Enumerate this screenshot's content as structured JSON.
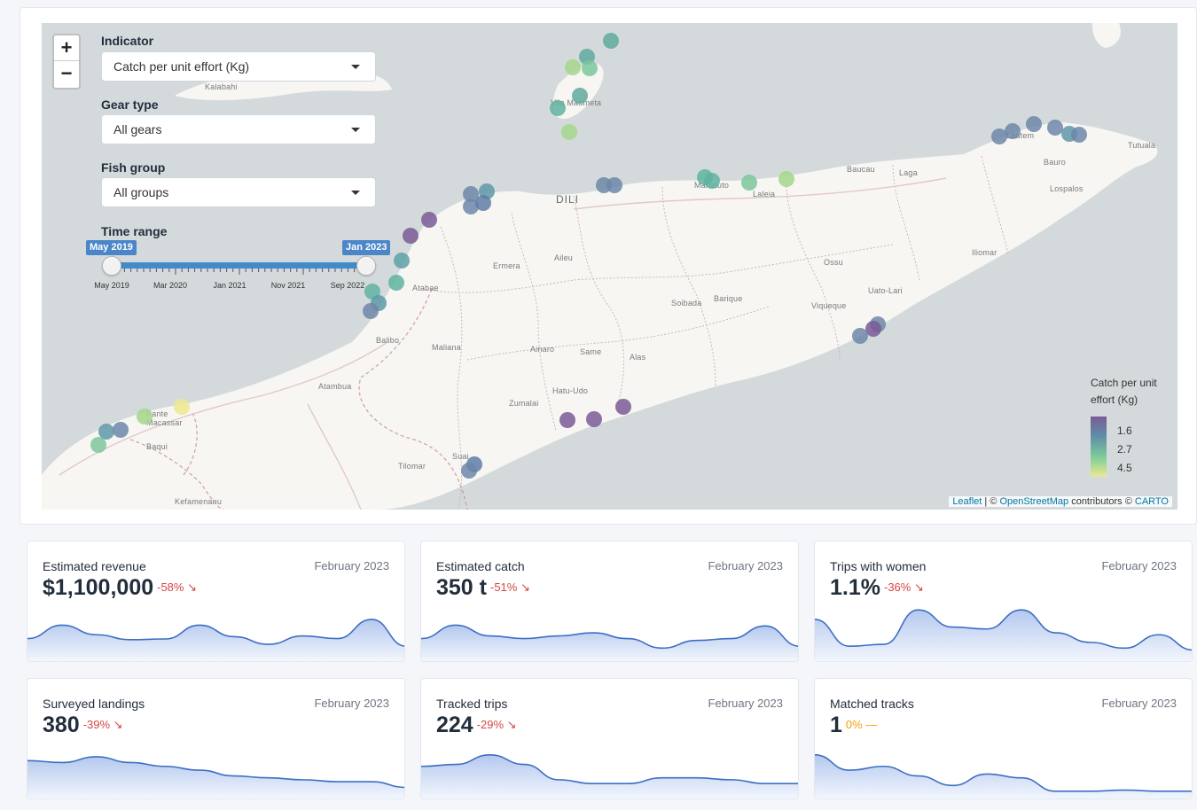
{
  "map": {
    "zoom_in": "+",
    "zoom_out": "−",
    "indicator": {
      "label": "Indicator",
      "value": "Catch per unit effort (Kg)"
    },
    "gear": {
      "label": "Gear type",
      "value": "All gears"
    },
    "fish": {
      "label": "Fish group",
      "value": "All groups"
    },
    "time": {
      "label": "Time range",
      "start": "May 2019",
      "end": "Jan 2023",
      "ticks": [
        "May 2019",
        "Mar 2020",
        "Jan 2021",
        "Nov 2021",
        "Sep 2022"
      ]
    },
    "places": {
      "dili": "DILI",
      "kalabahi": "Kalabahi",
      "vila_maumeta": "Vila Maumeta",
      "manatuto": "Manatuto",
      "laleia": "Laleia",
      "baucau": "Baucau",
      "laga": "Laga",
      "lautem": "Lautem",
      "tutuala": "Tutuala",
      "bauro": "Bauro",
      "lospalos": "Lospalos",
      "iliomar": "Iliomar",
      "ossu": "Ossu",
      "uato_lari": "Uato-Lari",
      "viqueque": "Viqueque",
      "barique": "Barique",
      "soibada": "Soibada",
      "ermera": "Ermera",
      "aileu": "Aileu",
      "atabae": "Atabae",
      "balibo": "Balibo",
      "maliana": "Maliana",
      "ainaro": "Ainaro",
      "same": "Same",
      "alas": "Alas",
      "hatu_udo": "Hatu-Udo",
      "zumalai": "Zumalai",
      "atambua": "Atambua",
      "pante_macassar": "Pante Macassar",
      "baqui": "Baqui",
      "tilomar": "Tilomar",
      "suai": "Suai",
      "kefamenanu": "Kefamenanu"
    },
    "legend": {
      "title": "Catch per unit effort (Kg)",
      "values": [
        "1.6",
        "2.7",
        "4.5"
      ],
      "colors": [
        "#7a5b96",
        "#5f8fa7",
        "#7ccc9a",
        "#ece98f"
      ]
    },
    "attribution": {
      "leaflet": "Leaflet",
      "sep": " | © ",
      "osm": "OpenStreetMap",
      "mid": " contributors © ",
      "carto": "CARTO"
    }
  },
  "kpis": [
    {
      "title": "Estimated revenue",
      "period": "February 2023",
      "value": "$1,100,000",
      "delta": "-58% ↘",
      "trend": "down",
      "spark": [
        0.45,
        0.8,
        0.55,
        0.42,
        0.44,
        0.8,
        0.5,
        0.3,
        0.52,
        0.45,
        0.95,
        0.25
      ]
    },
    {
      "title": "Estimated catch",
      "period": "February 2023",
      "value": "350 t",
      "delta": "-51% ↘",
      "trend": "down",
      "spark": [
        0.45,
        0.8,
        0.52,
        0.45,
        0.52,
        0.6,
        0.45,
        0.2,
        0.4,
        0.45,
        0.78,
        0.25
      ]
    },
    {
      "title": "Trips with women",
      "period": "February 2023",
      "value": "1.1%",
      "delta": "-36% ↘",
      "trend": "down",
      "spark": [
        0.95,
        0.25,
        0.3,
        1.2,
        0.75,
        0.7,
        1.2,
        0.6,
        0.35,
        0.2,
        0.55,
        0.15
      ]
    },
    {
      "title": "Surveyed landings",
      "period": "February 2023",
      "value": "380",
      "delta": "-39% ↘",
      "trend": "down",
      "spark": [
        0.85,
        0.8,
        0.95,
        0.8,
        0.7,
        0.6,
        0.45,
        0.4,
        0.35,
        0.3,
        0.3,
        0.15
      ]
    },
    {
      "title": "Tracked trips",
      "period": "February 2023",
      "value": "224",
      "delta": "-29% ↘",
      "trend": "down",
      "spark": [
        0.7,
        0.75,
        1.0,
        0.75,
        0.35,
        0.25,
        0.25,
        0.4,
        0.4,
        0.35,
        0.25,
        0.25
      ]
    },
    {
      "title": "Matched tracks",
      "period": "February 2023",
      "value": "1",
      "delta": "0% —",
      "trend": "flat",
      "spark": [
        1.0,
        0.6,
        0.7,
        0.45,
        0.2,
        0.5,
        0.4,
        0.05,
        0.05,
        0.08,
        0.05,
        0.05
      ]
    }
  ],
  "colors": {
    "down": "#d64545",
    "flat": "#f59f00",
    "spark_line": "#3d6fc4",
    "spark_fill_top": "#b4c8ee",
    "spark_fill_bottom": "#f2f6fd",
    "land": "#f7f6f3",
    "sea": "#d4dadc"
  }
}
